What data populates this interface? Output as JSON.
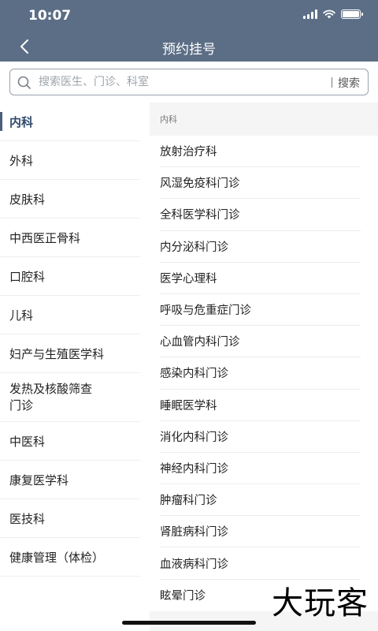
{
  "status": {
    "time": "10:07"
  },
  "header": {
    "title": "预约挂号"
  },
  "search": {
    "placeholder": "搜索医生、门诊、科室",
    "button": "搜索"
  },
  "sidebar": {
    "items": [
      {
        "label": "内科",
        "active": true
      },
      {
        "label": "外科"
      },
      {
        "label": "皮肤科"
      },
      {
        "label": "中西医正骨科"
      },
      {
        "label": "口腔科"
      },
      {
        "label": "儿科"
      },
      {
        "label": "妇产与生殖医学科"
      },
      {
        "label": "发热及核酸筛查\n门诊"
      },
      {
        "label": "中医科"
      },
      {
        "label": "康复医学科"
      },
      {
        "label": "医技科"
      },
      {
        "label": "健康管理（体检）"
      }
    ]
  },
  "content": {
    "section": "内科",
    "departments": [
      "放射治疗科",
      "风湿免疫科门诊",
      "全科医学科门诊",
      "内分泌科门诊",
      "医学心理科",
      "呼吸与危重症门诊",
      "心血管内科门诊",
      "感染内科门诊",
      "睡眠医学科",
      "消化内科门诊",
      "神经内科门诊",
      "肿瘤科门诊",
      "肾脏病科门诊",
      "血液病科门诊",
      "眩晕门诊"
    ]
  },
  "watermark": "大玩客",
  "colors": {
    "header_bg": "#5c6e86",
    "active_text": "#2f4a6d",
    "content_bg": "#f5f5f6"
  }
}
